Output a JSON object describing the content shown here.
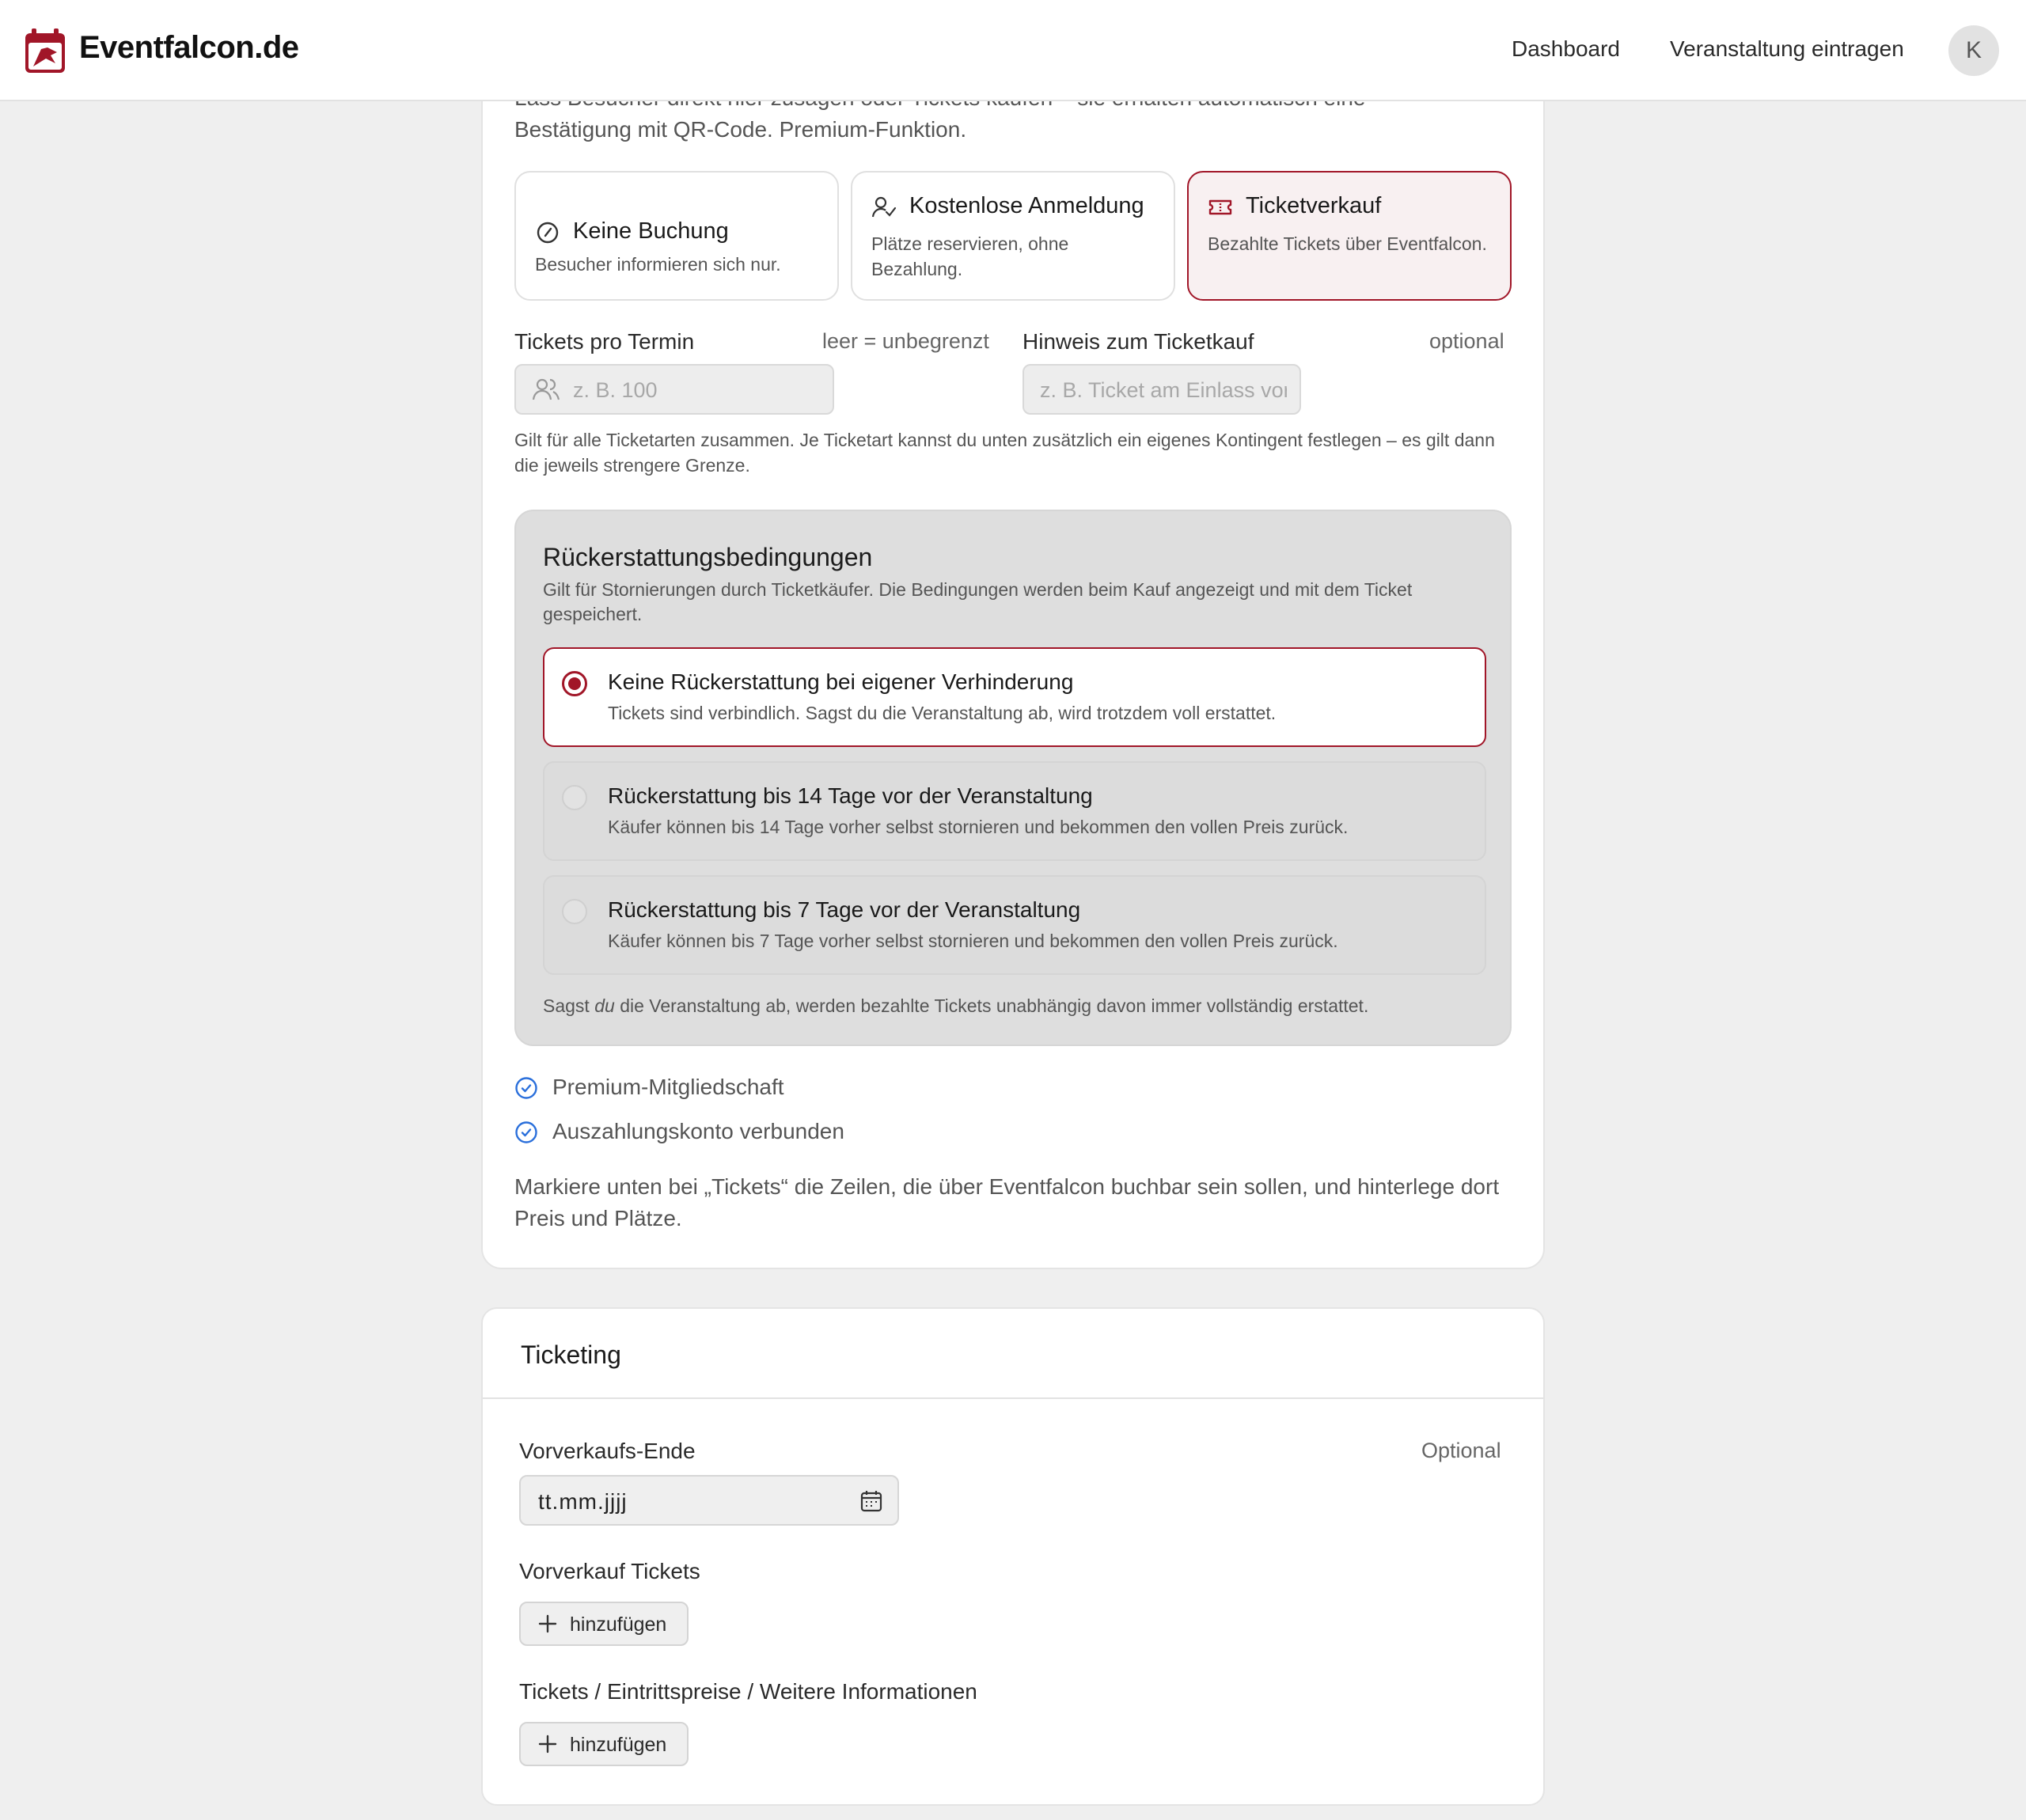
{
  "header": {
    "brand": "Eventfalcon.de",
    "nav": [
      "Dashboard",
      "Veranstaltung eintragen"
    ],
    "avatar_initial": "K"
  },
  "booking": {
    "intro_line1": "Lass Besucher direkt hier zusagen oder Tickets kaufen – sie erhalten automatisch eine",
    "intro_line2": "Bestätigung mit QR-Code. Premium-Funktion.",
    "options": [
      {
        "title": "Keine Buchung",
        "desc": "Besucher informieren sich nur.",
        "icon": "circle-slash-icon",
        "selected": false
      },
      {
        "title": "Kostenlose Anmeldung",
        "desc": "Plätze reservieren, ohne Bezahlung.",
        "icon": "user-check-icon",
        "selected": false
      },
      {
        "title": "Ticketverkauf",
        "desc": "Bezahlte Tickets über Eventfalcon.",
        "icon": "ticket-icon",
        "selected": true
      }
    ],
    "tickets_per_date": {
      "label": "Tickets pro Termin",
      "aside": "leer = unbegrenzt",
      "placeholder": "z. B. 100"
    },
    "ticket_note": {
      "label": "Hinweis zum Ticketkauf",
      "aside": "optional",
      "placeholder": "z. B. Ticket am Einlass vorzeigen"
    },
    "hint": "Gilt für alle Ticketarten zusammen. Je Ticketart kannst du unten zusätzlich ein eigenes Kontingent festlegen – es gilt dann die jeweils strengere Grenze."
  },
  "refund": {
    "title": "Rückerstattungsbedingungen",
    "subtitle": "Gilt für Stornierungen durch Ticketkäufer. Die Bedingungen werden beim Kauf angezeigt und mit dem Ticket gespeichert.",
    "options": [
      {
        "title": "Keine Rückerstattung bei eigener Verhinderung",
        "desc": "Tickets sind verbindlich. Sagst du die Veranstaltung ab, wird trotzdem voll erstattet.",
        "selected": true
      },
      {
        "title": "Rückerstattung bis 14 Tage vor der Veranstaltung",
        "desc": "Käufer können bis 14 Tage vorher selbst stornieren und bekommen den vollen Preis zurück.",
        "selected": false
      },
      {
        "title": "Rückerstattung bis 7 Tage vor der Veranstaltung",
        "desc": "Käufer können bis 7 Tage vorher selbst stornieren und bekommen den vollen Preis zurück.",
        "selected": false
      }
    ],
    "foot_pre": "Sagst ",
    "foot_em": "du",
    "foot_post": " die Veranstaltung ab, werden bezahlte Tickets unabhängig davon immer vollständig erstattet."
  },
  "requirements": [
    "Premium-Mitgliedschaft",
    "Auszahlungskonto verbunden"
  ],
  "instruction": "Markiere unten bei „Tickets“ die Zeilen, die über Eventfalcon buchbar sein sollen, und hinterlege dort Preis und Plätze.",
  "ticketing": {
    "title": "Ticketing",
    "presale_end": {
      "label": "Vorverkaufs-Ende",
      "aside": "Optional",
      "value": "tt.mm.jjjj"
    },
    "presale_tickets": {
      "label": "Vorverkauf Tickets",
      "button": "hinzufügen"
    },
    "tickets_prices": {
      "label": "Tickets / Eintrittspreise / Weitere Informationen",
      "button": "hinzufügen"
    }
  },
  "colors": {
    "accent": "#a11628",
    "check": "#2a6fdb"
  }
}
